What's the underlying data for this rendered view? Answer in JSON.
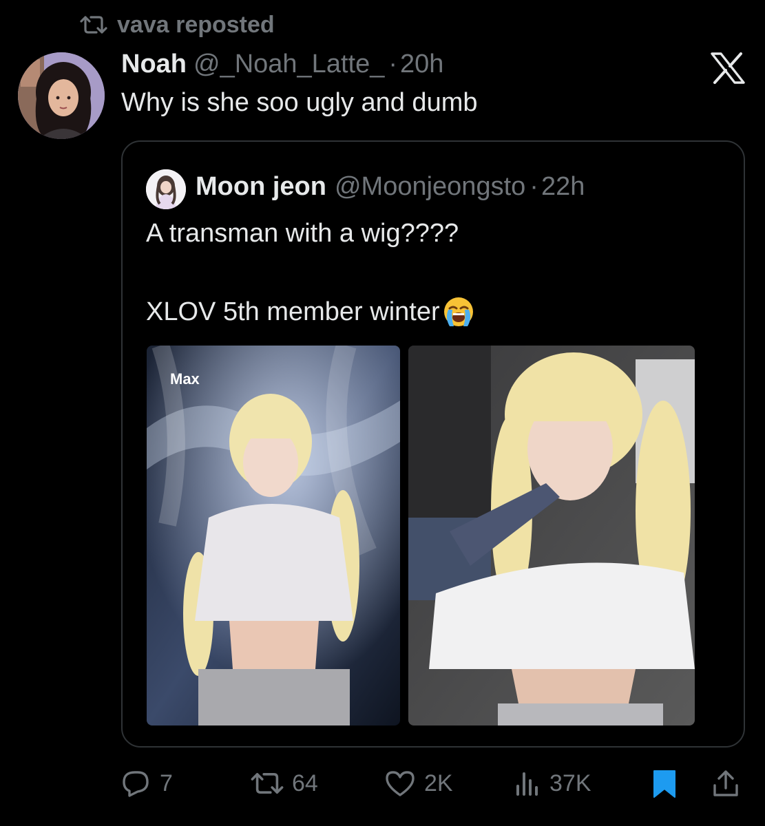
{
  "repost_banner": {
    "text": "vava reposted",
    "icon": "repost-icon"
  },
  "tweet": {
    "author_name": "Noah",
    "author_handle": "@_Noah_Latte_",
    "separator": "·",
    "time": "20h",
    "text": "Why is she soo ugly and dumb",
    "avatar_icon": "avatar-illustration"
  },
  "logo": {
    "icon": "x-logo-icon"
  },
  "quoted_tweet": {
    "author_name": "Moon jeon",
    "author_handle": "@Moonjeongsto",
    "separator": "·",
    "time": "22h",
    "text_line_1": "A transman with a wig????",
    "text_line_2": "XLOV 5th member winter",
    "emoji": "loudly-crying-face-emoji",
    "photo_1_overlay": "Max",
    "photos": [
      "stage-photo",
      "backstage-photo"
    ]
  },
  "actions": {
    "replies": "7",
    "reposts": "64",
    "likes": "2K",
    "views": "37K"
  },
  "colors": {
    "background": "#000000",
    "text_primary": "#e7e9ea",
    "text_secondary": "#71767b",
    "border": "#2f3336",
    "bookmark_active": "#1d9bf0"
  }
}
